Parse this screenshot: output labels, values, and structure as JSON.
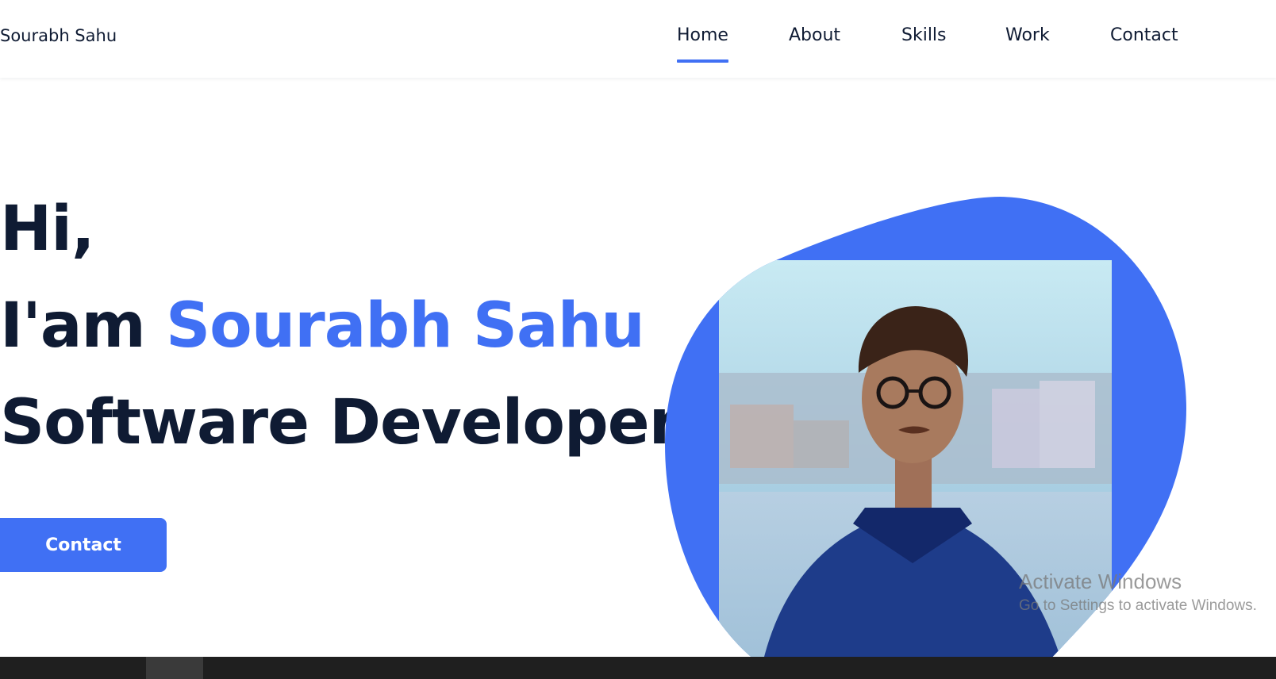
{
  "brand": {
    "name": "Sourabh Sahu"
  },
  "nav": {
    "items": [
      {
        "label": "Home",
        "active": true
      },
      {
        "label": "About",
        "active": false
      },
      {
        "label": "Skills",
        "active": false
      },
      {
        "label": "Work",
        "active": false
      },
      {
        "label": "Contact",
        "active": false
      }
    ]
  },
  "hero": {
    "greeting": "Hi,",
    "intro_prefix": "I'am",
    "name": "Sourabh Sahu",
    "role": "Software Developer",
    "cta_label": "Contact"
  },
  "watermark": {
    "title": "Activate Windows",
    "subtitle": "Go to Settings to activate Windows."
  },
  "colors": {
    "accent": "#4070f4",
    "text": "#0f1b33"
  },
  "icons": {
    "profile_photo": "person-photo"
  }
}
